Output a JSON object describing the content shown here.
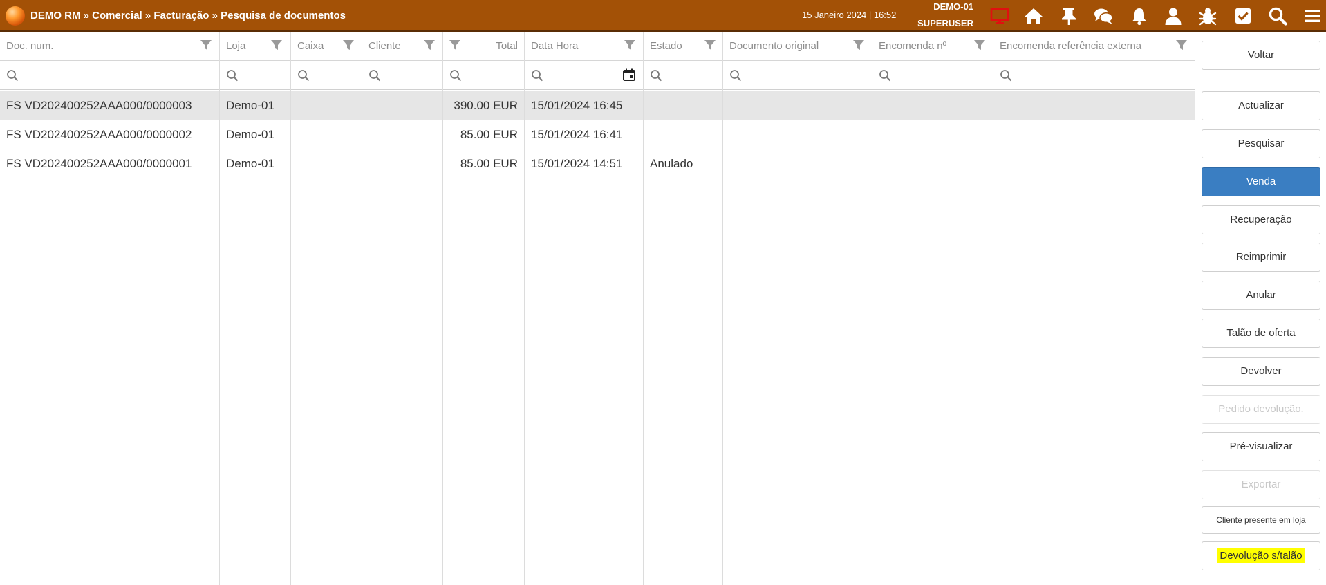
{
  "header": {
    "breadcrumb": "DEMO RM » Comercial » Facturação » Pesquisa de documentos",
    "datetime": "15 Janeiro 2024 | 16:52",
    "store": "DEMO-01",
    "user": "SUPERUSER",
    "icons": [
      "monitor-icon",
      "home-icon",
      "pin-icon",
      "chat-icon",
      "bell-icon",
      "user-icon",
      "bug-icon",
      "checkbox-icon",
      "search-icon",
      "menu-icon"
    ]
  },
  "columns": [
    {
      "label": "Doc. num."
    },
    {
      "label": "Loja"
    },
    {
      "label": "Caixa"
    },
    {
      "label": "Cliente"
    },
    {
      "label": "Total"
    },
    {
      "label": "Data Hora"
    },
    {
      "label": "Estado"
    },
    {
      "label": "Documento original"
    },
    {
      "label": "Encomenda nº"
    },
    {
      "label": "Encomenda referência externa"
    }
  ],
  "rows": [
    {
      "doc": "FS VD202400252AAA000/0000003",
      "loja": "Demo-01",
      "caixa": "",
      "cliente": "",
      "total": "390.00 EUR",
      "data": "15/01/2024 16:45",
      "estado": "",
      "original": "",
      "encomenda": "",
      "ref": ""
    },
    {
      "doc": "FS VD202400252AAA000/0000002",
      "loja": "Demo-01",
      "caixa": "",
      "cliente": "",
      "total": "85.00 EUR",
      "data": "15/01/2024 16:41",
      "estado": "",
      "original": "",
      "encomenda": "",
      "ref": ""
    },
    {
      "doc": "FS VD202400252AAA000/0000001",
      "loja": "Demo-01",
      "caixa": "",
      "cliente": "",
      "total": "85.00 EUR",
      "data": "15/01/2024 14:51",
      "estado": "Anulado",
      "original": "",
      "encomenda": "",
      "ref": ""
    }
  ],
  "sidebar": {
    "voltar": "Voltar",
    "actualizar": "Actualizar",
    "pesquisar": "Pesquisar",
    "venda": "Venda",
    "recuperacao": "Recuperação",
    "reimprimir": "Reimprimir",
    "anular": "Anular",
    "talao_oferta": "Talão de oferta",
    "devolver": "Devolver",
    "pedido_devolucao": "Pedido devolução.",
    "pre_visualizar": "Pré-visualizar",
    "exportar": "Exportar",
    "cliente_presente": "Cliente presente em loja",
    "devolucao_s_talao": "Devolução s/talão"
  },
  "colors": {
    "topbar": "#a35106",
    "primary": "#3a7ec2",
    "highlight": "#ffff00",
    "selected_row": "#e6e6e6",
    "monitor_icon": "#e01010"
  }
}
